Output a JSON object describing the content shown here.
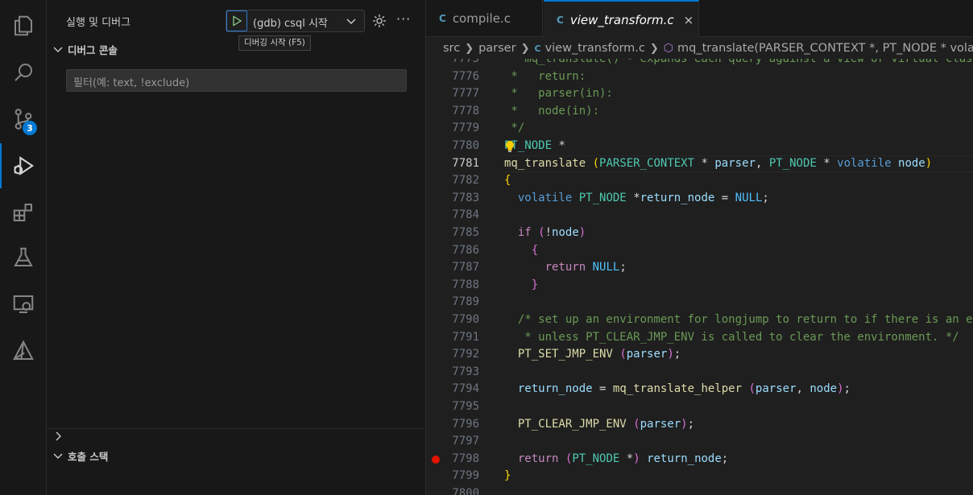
{
  "sidebar": {
    "title": "실행 및 디버그",
    "launch_config": "(gdb) csql 시작",
    "start_tooltip": "디버깅 시작 (F5)",
    "more_label": "···",
    "console_section": "디버그 콘솔",
    "filter_placeholder": "필터(예: text, !exclude)",
    "call_stack_section": "호출 스택"
  },
  "activity_bar": {
    "items": [
      "explorer-icon",
      "search-icon",
      "source-control-icon",
      "run-debug-icon",
      "extensions-icon",
      "testing-icon",
      "remote-explorer-icon",
      "cmake-icon"
    ],
    "source_control_badge": "3",
    "active": "run-debug-icon"
  },
  "tabs": [
    {
      "label": "compile.c",
      "active": false
    },
    {
      "label": "view_transform.c",
      "active": true,
      "close": "×"
    }
  ],
  "breadcrumbs": {
    "folder1": "src",
    "folder2": "parser",
    "file": "view_transform.c",
    "symbol": "mq_translate(PARSER_CONTEXT *, PT_NODE * volatile node)"
  },
  "editor": {
    "current_line": "7781",
    "breakpoint_line": "7798",
    "lines": [
      {
        "n": "7775",
        "text": " * mq_translate() - expands each query against a view or virtual class"
      },
      {
        "n": "7776",
        "text": " *   return:"
      },
      {
        "n": "7777",
        "text": " *   parser(in):"
      },
      {
        "n": "7778",
        "text": " *   node(in):"
      },
      {
        "n": "7779",
        "text": " */"
      },
      {
        "n": "7780",
        "text": "PT_NODE *"
      },
      {
        "n": "7781",
        "text": "mq_translate (PARSER_CONTEXT * parser, PT_NODE * volatile node)"
      },
      {
        "n": "7782",
        "text": "{"
      },
      {
        "n": "7783",
        "text": "  volatile PT_NODE *return_node = NULL;"
      },
      {
        "n": "7784",
        "text": ""
      },
      {
        "n": "7785",
        "text": "  if (!node)"
      },
      {
        "n": "7786",
        "text": "    {"
      },
      {
        "n": "7787",
        "text": "      return NULL;"
      },
      {
        "n": "7788",
        "text": "    }"
      },
      {
        "n": "7789",
        "text": ""
      },
      {
        "n": "7790",
        "text": "  /* set up an environment for longjump to return to if there is an error"
      },
      {
        "n": "7791",
        "text": "   * unless PT_CLEAR_JMP_ENV is called to clear the environment. */"
      },
      {
        "n": "7792",
        "text": "  PT_SET_JMP_ENV (parser);"
      },
      {
        "n": "7793",
        "text": ""
      },
      {
        "n": "7794",
        "text": "  return_node = mq_translate_helper (parser, node);"
      },
      {
        "n": "7795",
        "text": ""
      },
      {
        "n": "7796",
        "text": "  PT_CLEAR_JMP_ENV (parser);"
      },
      {
        "n": "7797",
        "text": ""
      },
      {
        "n": "7798",
        "text": "  return (PT_NODE *) return_node;"
      },
      {
        "n": "7799",
        "text": "}"
      },
      {
        "n": "7800",
        "text": ""
      }
    ]
  }
}
